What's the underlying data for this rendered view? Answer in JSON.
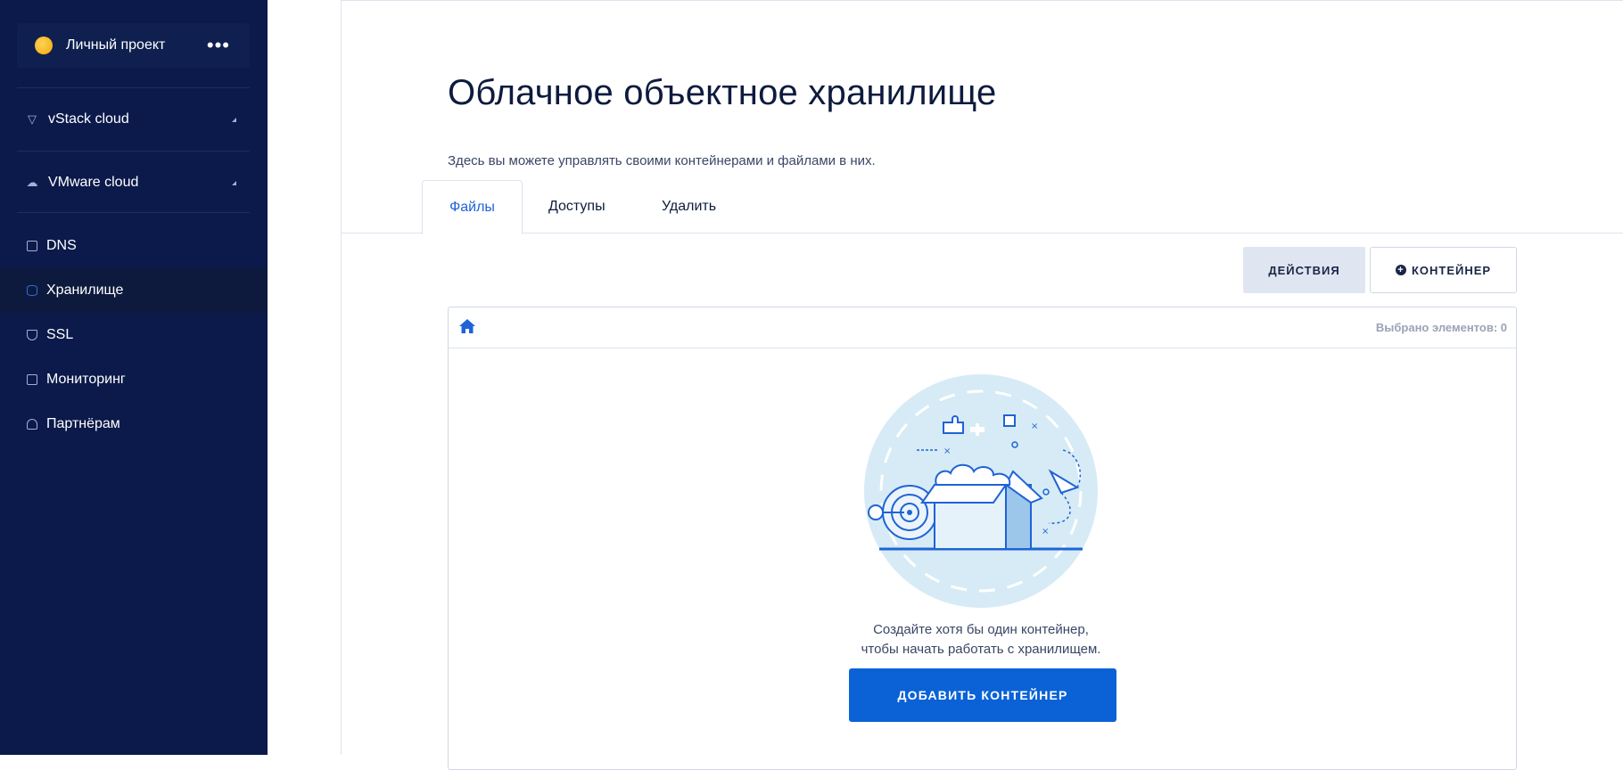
{
  "sidebar": {
    "project": {
      "name": "Личный проект",
      "more_icon": "more-horizontal-icon",
      "avatar_color": "#f2a900"
    },
    "groups": [
      {
        "label": "vStack cloud",
        "icon": "triangle-down-outline-icon"
      },
      {
        "label": "VMware cloud",
        "icon": "cloud-icon"
      }
    ],
    "items": [
      {
        "label": "DNS",
        "icon": "dns-icon"
      },
      {
        "label": "Хранилище",
        "icon": "database-icon"
      },
      {
        "label": "SSL",
        "icon": "shield-icon"
      },
      {
        "label": "Мониторинг",
        "icon": "monitor-icon"
      },
      {
        "label": "Партнёрам",
        "icon": "person-icon"
      }
    ],
    "active_item": "Хранилище"
  },
  "main": {
    "title": "Облачное объектное хранилище",
    "subtitle": "Здесь вы можете управлять своими контейнерами и файлами в них.",
    "tabs": [
      {
        "label": "Файлы",
        "active": true
      },
      {
        "label": "Доступы",
        "active": false
      },
      {
        "label": "Удалить",
        "active": false
      }
    ],
    "toolbar": {
      "actions_label": "ДЕЙСТВИЯ",
      "container_label": "КОНТЕЙНЕР",
      "container_icon": "plus-circle-icon"
    },
    "browser": {
      "home_icon": "home-icon",
      "selected_label": "Выбрано элементов: 0",
      "empty_text_line1": "Создайте хотя бы один контейнер,",
      "empty_text_line2": "чтобы начать работать с хранилищем.",
      "add_button_label": "ДОБАВИТЬ КОНТЕЙНЕР"
    }
  },
  "colors": {
    "sidebar_bg": "#0b1a4a",
    "accent": "#0a62d6",
    "active_tab_text": "#1f63d6",
    "illustration_bg": "#d6ebf5"
  }
}
